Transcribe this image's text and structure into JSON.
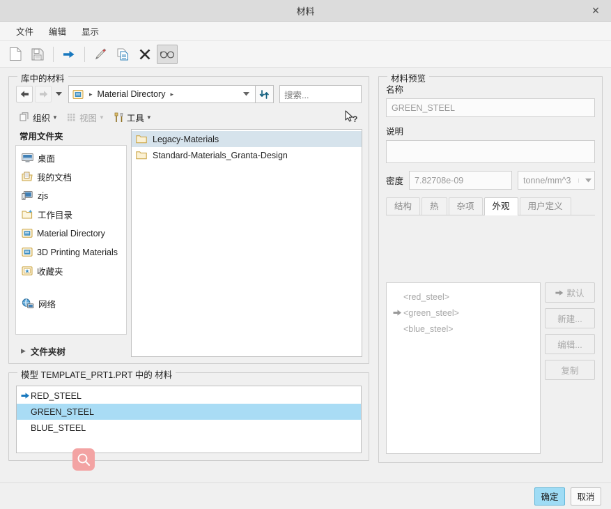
{
  "window": {
    "title": "材料",
    "close_label": "✕"
  },
  "menu": {
    "items": [
      {
        "label": "文件",
        "name": "menu-file"
      },
      {
        "label": "编辑",
        "name": "menu-edit"
      },
      {
        "label": "显示",
        "name": "menu-view"
      }
    ]
  },
  "toolbar": {
    "buttons": [
      {
        "name": "new-icon",
        "tooltip": "新建"
      },
      {
        "name": "save-icon",
        "tooltip": "保存"
      },
      {
        "name": "assign-arrow-icon",
        "tooltip": "指定"
      },
      {
        "name": "edit-pencil-icon",
        "tooltip": "编辑"
      },
      {
        "name": "copy-icon",
        "tooltip": "复制"
      },
      {
        "name": "delete-x-icon",
        "tooltip": "删除"
      },
      {
        "name": "show-glasses-icon",
        "tooltip": "显示"
      }
    ]
  },
  "library": {
    "legend": "库中的材料",
    "address": {
      "root_crumb": "Material Directory",
      "sep": "▸",
      "search_placeholder": "搜索..."
    },
    "tools": [
      {
        "label": "组织",
        "name": "organize-menu",
        "disabled": false
      },
      {
        "label": "视图",
        "name": "view-menu",
        "disabled": true
      },
      {
        "label": "工具",
        "name": "tools-menu",
        "disabled": false
      }
    ],
    "places_title": "常用文件夹",
    "places": [
      {
        "label": "桌面",
        "icon": "desktop-icon"
      },
      {
        "label": "我的文档",
        "icon": "documents-icon"
      },
      {
        "label": "zjs",
        "icon": "computer-icon"
      },
      {
        "label": "工作目录",
        "icon": "working-directory-icon"
      },
      {
        "label": "Material Directory",
        "icon": "material-directory-icon"
      },
      {
        "label": "3D Printing Materials",
        "icon": "printing-materials-icon"
      },
      {
        "label": "收藏夹",
        "icon": "favorites-icon"
      }
    ],
    "network": {
      "label": "网络",
      "icon": "network-icon"
    },
    "folder_tree_label": "文件夹树",
    "folders": [
      {
        "label": "Legacy-Materials",
        "selected": true
      },
      {
        "label": "Standard-Materials_Granta-Design",
        "selected": false
      }
    ]
  },
  "preview": {
    "legend": "材料预览",
    "name_label": "名称",
    "name_value": "GREEN_STEEL",
    "desc_label": "说明",
    "desc_value": "",
    "density_label": "密度",
    "density_value": "7.82708e-09",
    "density_unit": "tonne/mm^3",
    "tabs": [
      {
        "label": "结构",
        "active": false
      },
      {
        "label": "热",
        "active": false
      },
      {
        "label": "杂项",
        "active": false
      },
      {
        "label": "外观",
        "active": true
      },
      {
        "label": "用户定义",
        "active": false
      }
    ],
    "appearances": [
      {
        "label": "<red_steel>",
        "current": false
      },
      {
        "label": "<green_steel>",
        "current": true
      },
      {
        "label": "<blue_steel>",
        "current": false
      }
    ],
    "side_buttons": [
      {
        "label": "默认",
        "name": "default-button",
        "has_arrow": true
      },
      {
        "label": "新建...",
        "name": "new-button",
        "has_arrow": false
      },
      {
        "label": "编辑...",
        "name": "edit-button",
        "has_arrow": false
      },
      {
        "label": "复制",
        "name": "copy-button",
        "has_arrow": false
      }
    ]
  },
  "model": {
    "legend": "模型 TEMPLATE_PRT1.PRT 中的 材料",
    "materials": [
      {
        "label": "RED_STEEL",
        "current": true,
        "selected": false
      },
      {
        "label": "GREEN_STEEL",
        "current": false,
        "selected": true
      },
      {
        "label": "BLUE_STEEL",
        "current": false,
        "selected": false
      }
    ]
  },
  "footer": {
    "ok_label": "确定",
    "cancel_label": "取消"
  },
  "cursor": {
    "icon": "magnifier-icon",
    "color": "#f3a3a3"
  },
  "colors": {
    "selection_blue": "#a9dcf5",
    "folder_selection": "#d6e3ec",
    "primary_button": "#9fdcf5",
    "titlebar": "#dcdcdc",
    "window_bg": "#f0f0f0"
  }
}
